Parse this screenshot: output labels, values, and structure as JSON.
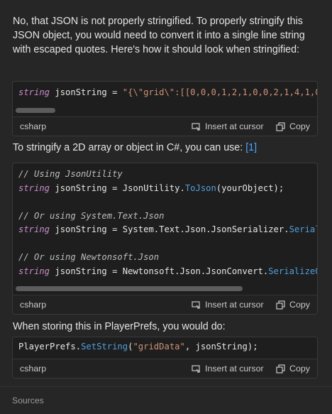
{
  "intro_text": "No, that JSON is not properly stringified. To properly stringify this JSON object, you would need to convert it into a single line string with escaped quotes. Here's how it should look when stringified:",
  "block1": {
    "code_kw": "string",
    "code_var": " jsonString = ",
    "code_str": "\"{\\\"grid\\\":[[0,0,0,1,2,1,0,0,2,1,4,1,0",
    "lang": "csharp"
  },
  "mid_text": "To stringify a 2D array or object in C#, you can use: ",
  "mid_ref": "[1]",
  "block2": {
    "c1": "// Using JsonUtility",
    "l1_kw": "string",
    "l1_a": " jsonString = JsonUtility.",
    "l1_fn": "ToJson",
    "l1_b": "(yourObject);",
    "c2": "// Or using System.Text.Json",
    "l2_kw": "string",
    "l2_a": " jsonString = System.Text.Json.JsonSerializer.",
    "l2_fn": "Serial",
    "c3": "// Or using Newtonsoft.Json",
    "l3_kw": "string",
    "l3_a": " jsonString = Newtonsoft.Json.JsonConvert.",
    "l3_fn": "SerializeOb",
    "lang": "csharp"
  },
  "bottom_text": "When storing this in PlayerPrefs, you would do:",
  "block3": {
    "a": "PlayerPrefs.",
    "fn": "SetString",
    "b": "(",
    "str": "\"gridData\"",
    "c": ", jsonString);",
    "lang": "csharp"
  },
  "actions": {
    "insert": "Insert at cursor",
    "copy": "Copy"
  },
  "sources_label": "Sources"
}
